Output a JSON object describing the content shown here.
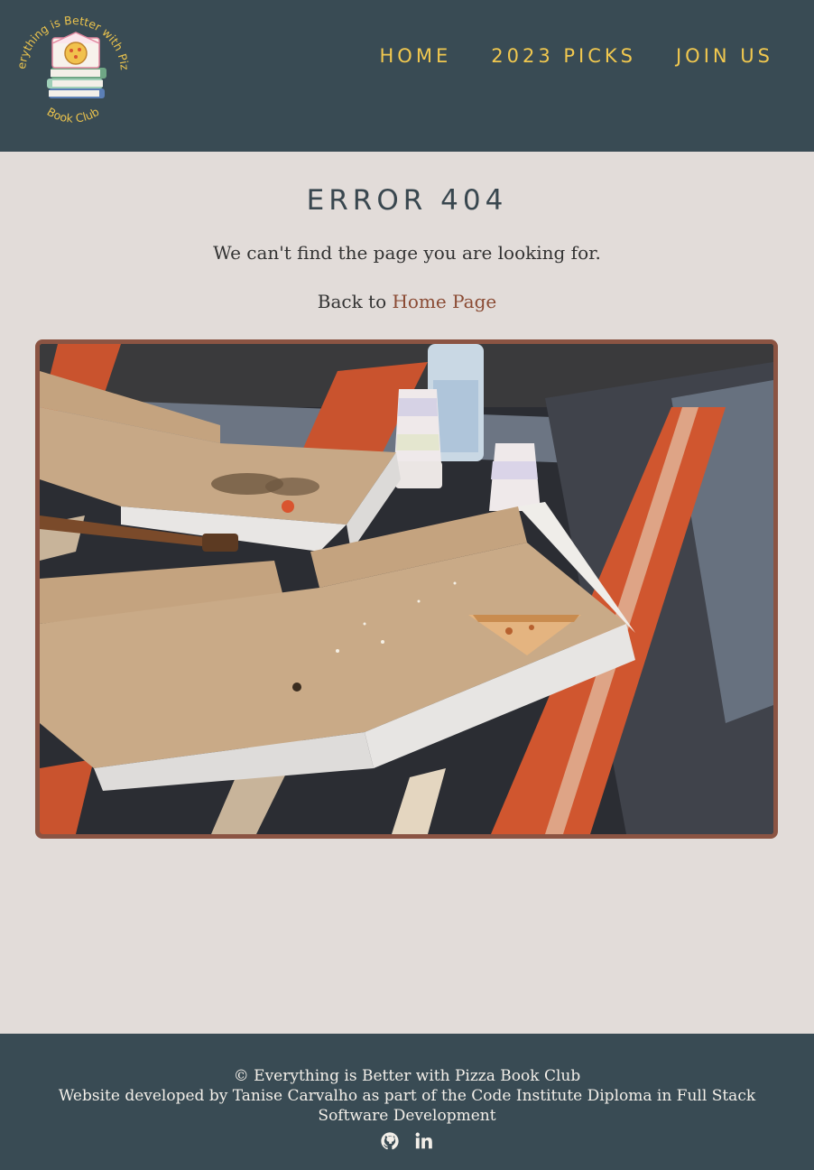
{
  "header": {
    "logo": {
      "text_top": "Everything is Better with Pizza",
      "text_bottom": "Book Club"
    },
    "nav": [
      {
        "label": "HOME"
      },
      {
        "label": "2023 PICKS"
      },
      {
        "label": "JOIN US"
      }
    ]
  },
  "main": {
    "title": "ERROR 404",
    "message": "We can't find the page you are looking for.",
    "back_prefix": "Back to ",
    "back_link": "Home Page",
    "image_icon": "photo-of-empty-pizza-boxes-on-rug"
  },
  "footer": {
    "copyright": "© Everything is Better with Pizza Book Club",
    "credit": "Website developed by Tanise Carvalho as part of the Code Institute Diploma in Full Stack Software Development",
    "social": [
      {
        "icon": "github-icon"
      },
      {
        "icon": "linkedin-icon"
      }
    ]
  },
  "colors": {
    "header_bg": "#394b54",
    "nav_text": "#f1c84f",
    "page_bg": "#e2dcd9",
    "link": "#8a4a33",
    "image_border": "#8b5443"
  }
}
